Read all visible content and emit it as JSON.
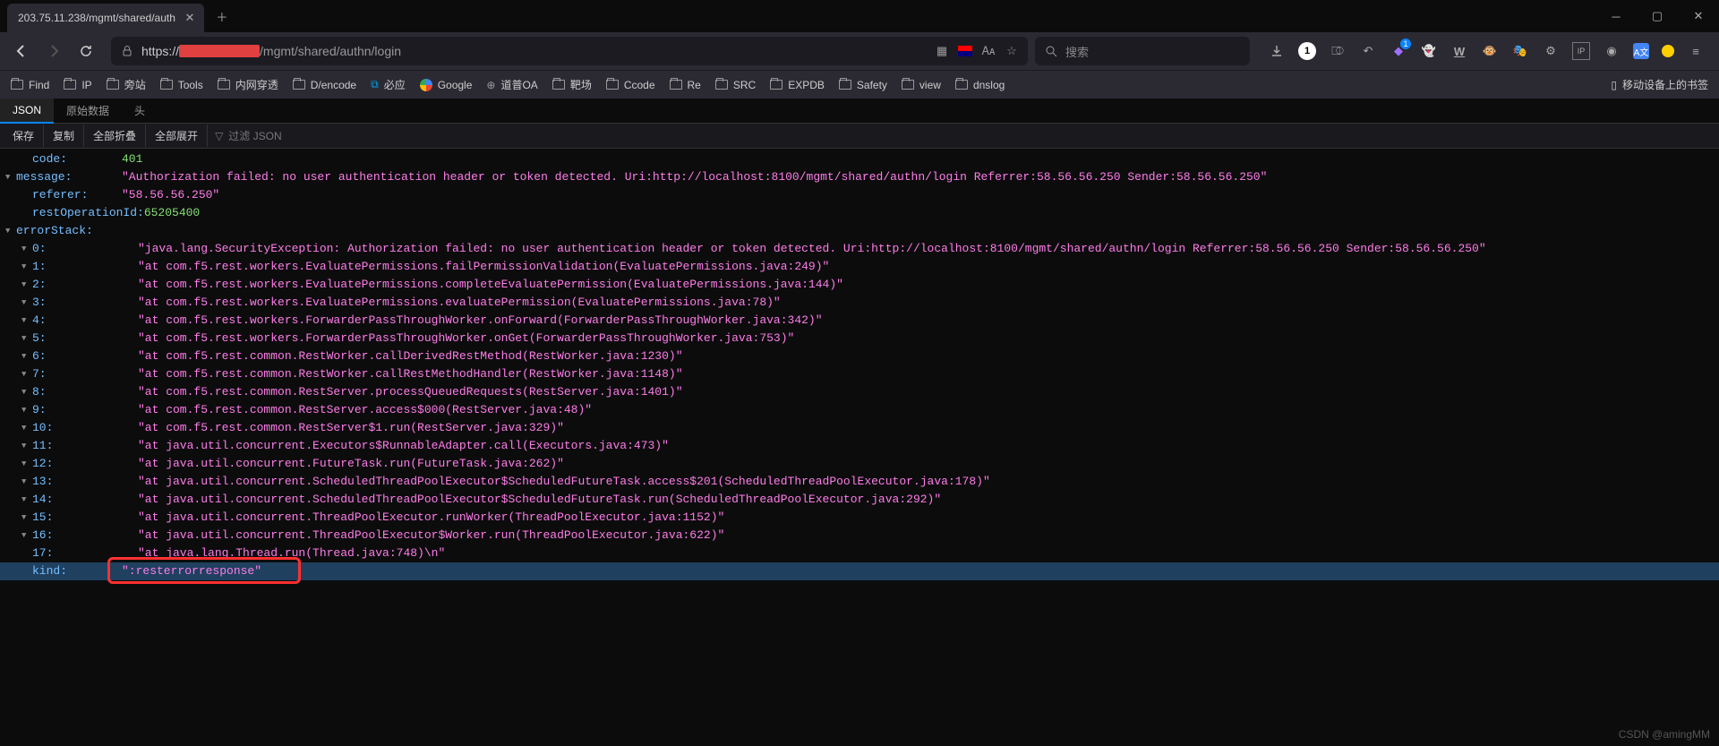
{
  "window": {
    "tab_title": "203.75.11.238/mgmt/shared/auth"
  },
  "nav": {
    "url_prefix": "https://",
    "url_path": "/mgmt/shared/authn/login",
    "search_placeholder": "搜索"
  },
  "bookmarks": {
    "items": [
      "Find",
      "IP",
      "旁站",
      "Tools",
      "内网穿透",
      "D/encode",
      "必应",
      "Google",
      "道普OA",
      "靶场",
      "Ccode",
      "Re",
      "SRC",
      "EXPDB",
      "Safety",
      "view",
      "dnslog"
    ],
    "mobile": "移动设备上的书签"
  },
  "json_header": {
    "tabs": [
      "JSON",
      "原始数据",
      "头"
    ],
    "buttons": [
      "保存",
      "复制",
      "全部折叠",
      "全部展开"
    ],
    "filter_placeholder": "过滤 JSON"
  },
  "json": {
    "code_key": "code:",
    "code_val": "401",
    "message_key": "message:",
    "message_val": "\"Authorization failed: no user authentication header or token detected. Uri:http://localhost:8100/mgmt/shared/authn/login Referrer:58.56.56.250 Sender:58.56.56.250\"",
    "referer_key": "referer:",
    "referer_val": "\"58.56.56.250\"",
    "restop_key": "restOperationId:",
    "restop_val": "65205400",
    "errorstack_key": "errorStack:",
    "stack": [
      {
        "k": "0:",
        "v": "\"java.lang.SecurityException: Authorization failed: no user authentication header or token detected. Uri:http://localhost:8100/mgmt/shared/authn/login Referrer:58.56.56.250 Sender:58.56.56.250\""
      },
      {
        "k": "1:",
        "v": "\"at com.f5.rest.workers.EvaluatePermissions.failPermissionValidation(EvaluatePermissions.java:249)\""
      },
      {
        "k": "2:",
        "v": "\"at com.f5.rest.workers.EvaluatePermissions.completeEvaluatePermission(EvaluatePermissions.java:144)\""
      },
      {
        "k": "3:",
        "v": "\"at com.f5.rest.workers.EvaluatePermissions.evaluatePermission(EvaluatePermissions.java:78)\""
      },
      {
        "k": "4:",
        "v": "\"at com.f5.rest.workers.ForwarderPassThroughWorker.onForward(ForwarderPassThroughWorker.java:342)\""
      },
      {
        "k": "5:",
        "v": "\"at com.f5.rest.workers.ForwarderPassThroughWorker.onGet(ForwarderPassThroughWorker.java:753)\""
      },
      {
        "k": "6:",
        "v": "\"at com.f5.rest.common.RestWorker.callDerivedRestMethod(RestWorker.java:1230)\""
      },
      {
        "k": "7:",
        "v": "\"at com.f5.rest.common.RestWorker.callRestMethodHandler(RestWorker.java:1148)\""
      },
      {
        "k": "8:",
        "v": "\"at com.f5.rest.common.RestServer.processQueuedRequests(RestServer.java:1401)\""
      },
      {
        "k": "9:",
        "v": "\"at com.f5.rest.common.RestServer.access$000(RestServer.java:48)\""
      },
      {
        "k": "10:",
        "v": "\"at com.f5.rest.common.RestServer$1.run(RestServer.java:329)\""
      },
      {
        "k": "11:",
        "v": "\"at java.util.concurrent.Executors$RunnableAdapter.call(Executors.java:473)\""
      },
      {
        "k": "12:",
        "v": "\"at java.util.concurrent.FutureTask.run(FutureTask.java:262)\""
      },
      {
        "k": "13:",
        "v": "\"at java.util.concurrent.ScheduledThreadPoolExecutor$ScheduledFutureTask.access$201(ScheduledThreadPoolExecutor.java:178)\""
      },
      {
        "k": "14:",
        "v": "\"at java.util.concurrent.ScheduledThreadPoolExecutor$ScheduledFutureTask.run(ScheduledThreadPoolExecutor.java:292)\""
      },
      {
        "k": "15:",
        "v": "\"at java.util.concurrent.ThreadPoolExecutor.runWorker(ThreadPoolExecutor.java:1152)\""
      },
      {
        "k": "16:",
        "v": "\"at java.util.concurrent.ThreadPoolExecutor$Worker.run(ThreadPoolExecutor.java:622)\""
      },
      {
        "k": "17:",
        "v": "\"at java.lang.Thread.run(Thread.java:748)\\n\""
      }
    ],
    "kind_key": "kind:",
    "kind_val": "\":resterrorresponse\""
  },
  "watermark": "CSDN @amingMM"
}
